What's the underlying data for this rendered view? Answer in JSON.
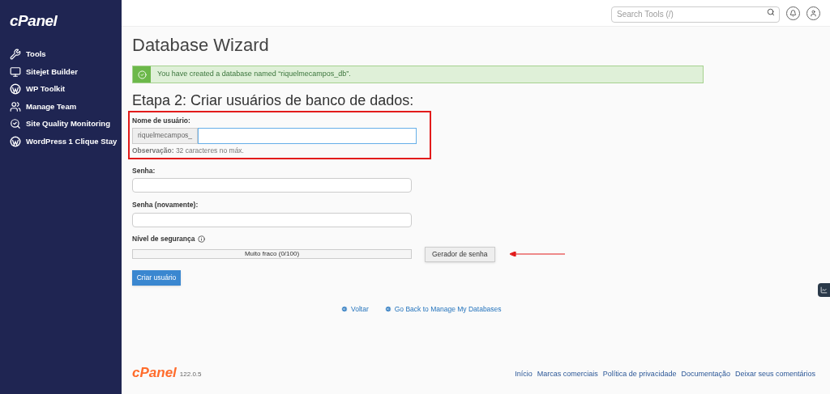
{
  "sidebar": {
    "logo": "cPanel",
    "items": [
      {
        "label": "Tools",
        "kind": "tools"
      },
      {
        "label": "Sitejet Builder",
        "kind": "monitor"
      },
      {
        "label": "WP Toolkit",
        "kind": "wordpress"
      },
      {
        "label": "Manage Team",
        "kind": "team"
      },
      {
        "label": "Site Quality Monitoring",
        "kind": "search"
      },
      {
        "label": "WordPress 1 Clique Stay",
        "kind": "wordpress"
      }
    ]
  },
  "header": {
    "search": {
      "placeholder": "Search Tools (/)"
    }
  },
  "page": {
    "title": "Database Wizard",
    "alert": {
      "text": "You have created a database named “riquelmecampos_db”."
    },
    "step_title": "Etapa 2: Criar usuários de banco de dados:",
    "username": {
      "label": "Nome de usuário:",
      "prefix": "riquelmecampos_",
      "note_label": "Observação:",
      "note": "32 caracteres no máx.",
      "highlighted": true
    },
    "password": {
      "label": "Senha:"
    },
    "password_again": {
      "label": "Senha (novamente):"
    },
    "strength": {
      "label": "Nível de segurança",
      "reading": "Muito fraco (0/100)",
      "level": 0
    },
    "generator_button": "Gerador de senha",
    "create_button": "Criar usuário",
    "links": [
      "Voltar",
      "Go Back to Manage My Databases"
    ]
  },
  "footer": {
    "logo": "cPanel",
    "version": "122.0.5",
    "links": [
      "Início",
      "Marcas comerciais",
      "Política de privacidade",
      "Documentação",
      "Deixar seus comentários"
    ]
  }
}
